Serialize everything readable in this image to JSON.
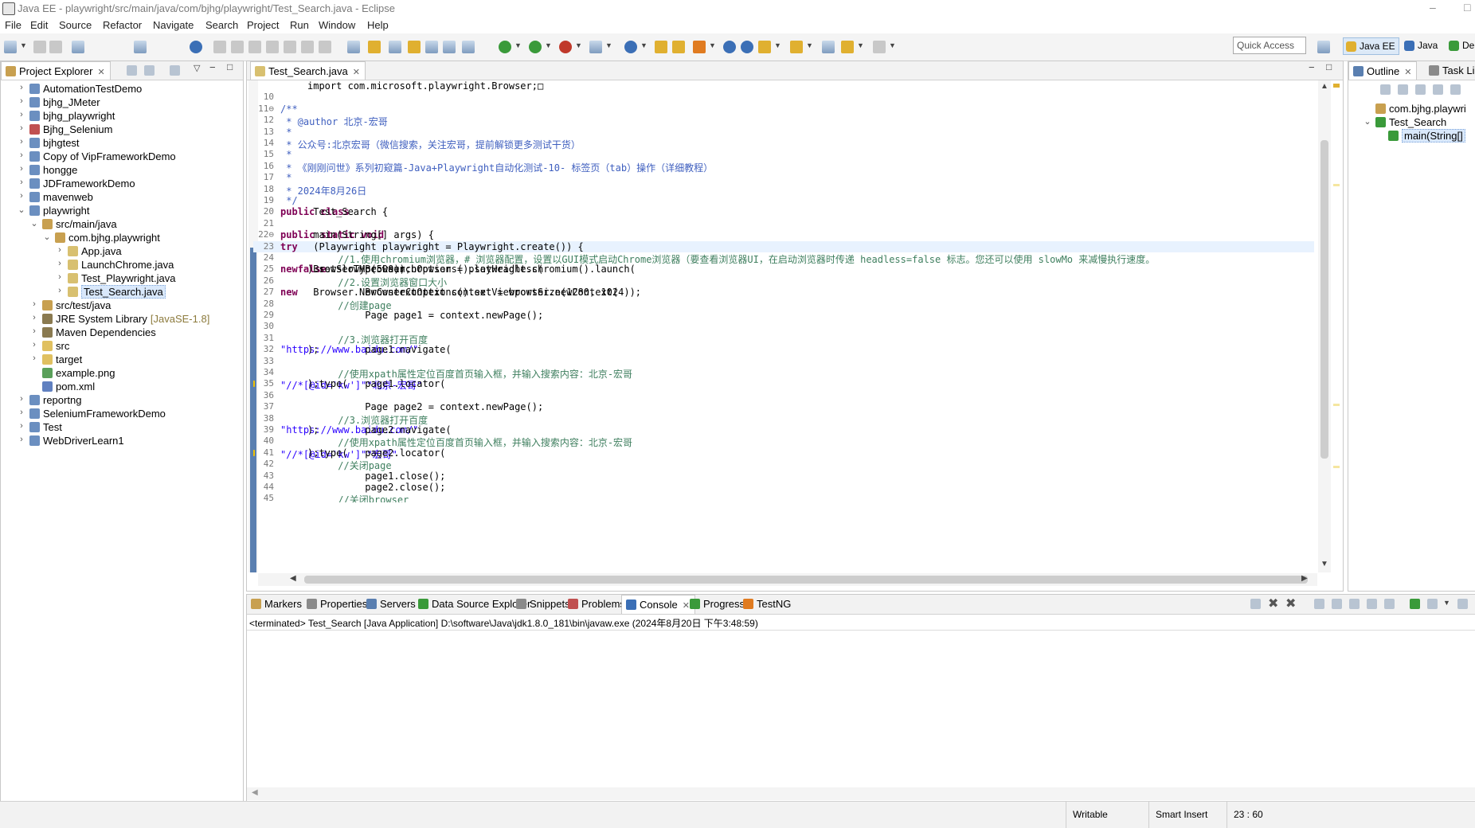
{
  "window": {
    "title": "Java EE - playwright/src/main/java/com/bjhg/playwright/Test_Search.java - Eclipse",
    "controls": [
      "–",
      "□"
    ]
  },
  "menu": [
    "File",
    "Edit",
    "Source",
    "Refactor",
    "Navigate",
    "Search",
    "Project",
    "Run",
    "Window",
    "Help"
  ],
  "toolbar": {
    "quick_access": "Quick Access",
    "perspectives": [
      "Java EE",
      "Java",
      "De"
    ]
  },
  "project_explorer": {
    "tab_label": "Project Explorer",
    "items": [
      {
        "label": "AutomationTestDemo",
        "depth": 0,
        "arrow": "›",
        "kind": "project"
      },
      {
        "label": "bjhg_JMeter",
        "depth": 0,
        "arrow": "›",
        "kind": "project"
      },
      {
        "label": "bjhg_playwright",
        "depth": 0,
        "arrow": "›",
        "kind": "project"
      },
      {
        "label": "Bjhg_Selenium",
        "depth": 0,
        "arrow": "›",
        "kind": "project-error"
      },
      {
        "label": "bjhgtest",
        "depth": 0,
        "arrow": "›",
        "kind": "project"
      },
      {
        "label": "Copy of VipFrameworkDemo",
        "depth": 0,
        "arrow": "›",
        "kind": "project"
      },
      {
        "label": "hongge",
        "depth": 0,
        "arrow": "›",
        "kind": "project"
      },
      {
        "label": "JDFrameworkDemo",
        "depth": 0,
        "arrow": "›",
        "kind": "project"
      },
      {
        "label": "mavenweb",
        "depth": 0,
        "arrow": "›",
        "kind": "project"
      },
      {
        "label": "playwright",
        "depth": 0,
        "arrow": "⌄",
        "kind": "project"
      },
      {
        "label": "src/main/java",
        "depth": 1,
        "arrow": "⌄",
        "kind": "srcfolder"
      },
      {
        "label": "com.bjhg.playwright",
        "depth": 2,
        "arrow": "⌄",
        "kind": "package"
      },
      {
        "label": "App.java",
        "depth": 3,
        "arrow": "›",
        "kind": "java"
      },
      {
        "label": "LaunchChrome.java",
        "depth": 3,
        "arrow": "›",
        "kind": "java"
      },
      {
        "label": "Test_Playwright.java",
        "depth": 3,
        "arrow": "›",
        "kind": "java"
      },
      {
        "label": "Test_Search.java",
        "depth": 3,
        "arrow": "›",
        "kind": "java",
        "selected": true
      },
      {
        "label": "src/test/java",
        "depth": 1,
        "arrow": "›",
        "kind": "srcfolder"
      },
      {
        "label": "JRE System Library",
        "decoration": "[JavaSE-1.8]",
        "depth": 1,
        "arrow": "›",
        "kind": "library"
      },
      {
        "label": "Maven Dependencies",
        "depth": 1,
        "arrow": "›",
        "kind": "library"
      },
      {
        "label": "src",
        "depth": 1,
        "arrow": "›",
        "kind": "folder"
      },
      {
        "label": "target",
        "depth": 1,
        "arrow": "›",
        "kind": "folder"
      },
      {
        "label": "example.png",
        "depth": 1,
        "arrow": "",
        "kind": "image"
      },
      {
        "label": "pom.xml",
        "depth": 1,
        "arrow": "",
        "kind": "xml"
      },
      {
        "label": "reportng",
        "depth": 0,
        "arrow": "›",
        "kind": "project"
      },
      {
        "label": "SeleniumFrameworkDemo",
        "depth": 0,
        "arrow": "›",
        "kind": "project"
      },
      {
        "label": "Test",
        "depth": 0,
        "arrow": "›",
        "kind": "project"
      },
      {
        "label": "WebDriverLearn1",
        "depth": 0,
        "arrow": "›",
        "kind": "project"
      }
    ]
  },
  "editor": {
    "tab_label": "Test_Search.java",
    "lines": [
      {
        "n": "",
        "segs": [
          [
            "cl",
            "import com.microsoft.playwright.Browser;□"
          ]
        ]
      },
      {
        "n": "10",
        "segs": []
      },
      {
        "n": "11⊖",
        "segs": [
          [
            "jd",
            "/**"
          ]
        ]
      },
      {
        "n": "12",
        "segs": [
          [
            "jd",
            " * @author 北京-宏哥"
          ]
        ]
      },
      {
        "n": "13",
        "segs": [
          [
            "jd",
            " *"
          ]
        ]
      },
      {
        "n": "14",
        "segs": [
          [
            "jd",
            " * 公众号:北京宏哥（微信搜索，关注宏哥，提前解锁更多测试干货）"
          ]
        ]
      },
      {
        "n": "15",
        "segs": [
          [
            "jd",
            " *"
          ]
        ]
      },
      {
        "n": "16",
        "segs": [
          [
            "jd",
            " * 《刚刚问世》系列初窥篇-Java+Playwright自动化测试-10- 标签页（tab）操作（详细教程）"
          ]
        ]
      },
      {
        "n": "17",
        "segs": [
          [
            "jd",
            " *"
          ]
        ]
      },
      {
        "n": "18",
        "segs": [
          [
            "jd",
            " * 2024年8月26日"
          ]
        ]
      },
      {
        "n": "19",
        "segs": [
          [
            "jd",
            " */"
          ]
        ]
      },
      {
        "n": "20",
        "segs": [
          [
            "kw",
            "public class"
          ],
          [
            "cl",
            " Test_Search {"
          ]
        ]
      },
      {
        "n": "21",
        "segs": []
      },
      {
        "n": "22⊖",
        "segs": [
          [
            "cl",
            "    "
          ],
          [
            "kw",
            "public static void"
          ],
          [
            "cl",
            " main(String[] args) {"
          ]
        ]
      },
      {
        "n": "23",
        "segs": [
          [
            "cl",
            "        "
          ],
          [
            "kw",
            "try"
          ],
          [
            "cl",
            " (Playwright playwright = Playwright.create()) {"
          ]
        ],
        "highlight": true
      },
      {
        "n": "24",
        "segs": [
          [
            "cm",
            "          //1.使用chromium浏览器，# 浏览器配置，设置以GUI模式启动Chrome浏览器（要查看浏览器UI，在启动浏览器时传递 headless=false 标志。您还可以使用 slowMo 来减慢执行速度。"
          ]
        ]
      },
      {
        "n": "25",
        "segs": [
          [
            "cl",
            "          Browser browser = playwright.chromium().launch("
          ],
          [
            "kw",
            "new"
          ],
          [
            "cl",
            " BrowserType.LaunchOptions().setHeadless("
          ],
          [
            "kw",
            "false"
          ],
          [
            "cl",
            ").setSlowMo(500));"
          ]
        ]
      },
      {
        "n": "26",
        "segs": [
          [
            "cm",
            "          //2.设置浏览器窗口大小"
          ]
        ]
      },
      {
        "n": "27",
        "segs": [
          [
            "cl",
            "          BrowserContext context = browser.newContext("
          ],
          [
            "kw",
            "new"
          ],
          [
            "cl",
            " Browser.NewContextOptions().setViewportSize(1280, 1024));"
          ]
        ]
      },
      {
        "n": "28",
        "segs": [
          [
            "cm",
            "          //创建page"
          ]
        ]
      },
      {
        "n": "29",
        "segs": [
          [
            "cl",
            "          Page page1 = context.newPage();"
          ]
        ]
      },
      {
        "n": "30",
        "segs": []
      },
      {
        "n": "31",
        "segs": [
          [
            "cm",
            "          //3.浏览器打开百度"
          ]
        ]
      },
      {
        "n": "32",
        "segs": [
          [
            "cl",
            "          page1.navigate("
          ],
          [
            "st",
            "\"https://www.baidu.com/\""
          ],
          [
            "cl",
            ");"
          ]
        ]
      },
      {
        "n": "33",
        "segs": []
      },
      {
        "n": "34",
        "segs": [
          [
            "cm",
            "          //使用xpath属性定位百度首页输入框，并输入搜索内容：北京-宏哥"
          ]
        ]
      },
      {
        "n": "35",
        "segs": [
          [
            "cl",
            "          page1.locator("
          ],
          [
            "st",
            "\"//*[@id='kw']\""
          ],
          [
            "cl",
            ").type("
          ],
          [
            "st",
            "\"北京-宏哥\""
          ],
          [
            "cl",
            ");"
          ]
        ],
        "warn": true
      },
      {
        "n": "36",
        "segs": []
      },
      {
        "n": "37",
        "segs": [
          [
            "cl",
            "          Page page2 = context.newPage();"
          ]
        ]
      },
      {
        "n": "38",
        "segs": [
          [
            "cm",
            "          //3.浏览器打开百度"
          ]
        ]
      },
      {
        "n": "39",
        "segs": [
          [
            "cl",
            "          page2.navigate("
          ],
          [
            "st",
            "\"https://www.baidu.com/\""
          ],
          [
            "cl",
            ");"
          ]
        ]
      },
      {
        "n": "40",
        "segs": [
          [
            "cm",
            "          //使用xpath属性定位百度首页输入框，并输入搜索内容：北京-宏哥"
          ]
        ]
      },
      {
        "n": "41",
        "segs": [
          [
            "cl",
            "          page2.locator("
          ],
          [
            "st",
            "\"//*[@id='kw']\""
          ],
          [
            "cl",
            ").type("
          ],
          [
            "st",
            "\"宏哥\""
          ],
          [
            "cl",
            ");"
          ]
        ],
        "warn": true
      },
      {
        "n": "42",
        "segs": [
          [
            "cm",
            "          //关闭page"
          ]
        ]
      },
      {
        "n": "43",
        "segs": [
          [
            "cl",
            "          page1.close();"
          ]
        ]
      },
      {
        "n": "44",
        "segs": [
          [
            "cl",
            "          page2.close();"
          ]
        ]
      },
      {
        "n": "45",
        "segs": [
          [
            "cm",
            "          //关闭browser"
          ]
        ]
      }
    ]
  },
  "outline": {
    "tab_label": "Outline",
    "tab2_label": "Task Li",
    "items": [
      {
        "label": "com.bjhg.playwri",
        "depth": 0,
        "kind": "package"
      },
      {
        "label": "Test_Search",
        "depth": 0,
        "arrow": "⌄",
        "kind": "class"
      },
      {
        "label": "main(String[]",
        "depth": 1,
        "kind": "method",
        "selected": true
      }
    ]
  },
  "bottom_tabs": [
    {
      "label": "Markers"
    },
    {
      "label": "Properties"
    },
    {
      "label": "Servers"
    },
    {
      "label": "Data Source Explorer"
    },
    {
      "label": "Snippets"
    },
    {
      "label": "Problems"
    },
    {
      "label": "Console",
      "active": true
    },
    {
      "label": "Progress"
    },
    {
      "label": "TestNG"
    }
  ],
  "console": {
    "header": "<terminated> Test_Search [Java Application] D:\\software\\Java\\jdk1.8.0_181\\bin\\javaw.exe (2024年8月20日 下午3:48:59)"
  },
  "status": {
    "writable": "Writable",
    "insert_mode": "Smart Insert",
    "position": "23 : 60"
  }
}
